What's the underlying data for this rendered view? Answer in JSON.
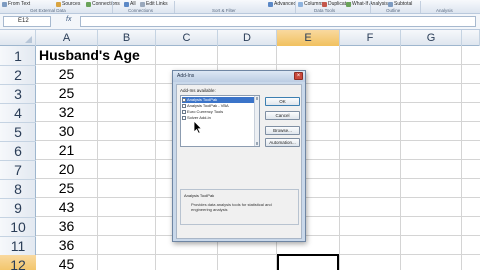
{
  "ribbon": {
    "items": [
      {
        "label": "From Text",
        "icon": "text-file-icon"
      },
      {
        "label": "Sources",
        "icon": "sources-icon"
      },
      {
        "label": "Connections",
        "icon": "connections-icon"
      },
      {
        "label": "All",
        "icon": "refresh-all-icon"
      },
      {
        "label": "Edit Links",
        "icon": "edit-links-icon"
      },
      {
        "label": "Advanced",
        "icon": "advanced-filter-icon"
      },
      {
        "label": "Columns",
        "icon": "text-to-columns-icon"
      },
      {
        "label": "Duplicates",
        "icon": "remove-duplicates-icon"
      },
      {
        "label": "What-If Analysis",
        "icon": "what-if-icon"
      },
      {
        "label": "Subtotal",
        "icon": "subtotal-icon"
      }
    ],
    "groups": [
      "Get External Data",
      "Connections",
      "Sort & Filter",
      "Data Tools",
      "Outline",
      "Analysis"
    ]
  },
  "formula_bar": {
    "name_box": "E12",
    "fx": "fx",
    "formula": ""
  },
  "grid": {
    "columns": [
      "A",
      "B",
      "C",
      "D",
      "E",
      "F",
      "G"
    ],
    "active_column": "E",
    "rows": [
      "1",
      "2",
      "3",
      "4",
      "5",
      "6",
      "7",
      "8",
      "9",
      "10",
      "11",
      "12"
    ],
    "active_row": "12",
    "header_cell": "Husband's Age",
    "ages": [
      "25",
      "25",
      "32",
      "30",
      "21",
      "20",
      "25",
      "43",
      "36",
      "36",
      "45"
    ]
  },
  "dialog": {
    "title": "Add-Ins",
    "close": "×",
    "list_label": "Add-Ins available:",
    "items": [
      {
        "label": "Analysis ToolPak",
        "checked": false,
        "selected": true
      },
      {
        "label": "Analysis ToolPak - VBA",
        "checked": false,
        "selected": false
      },
      {
        "label": "Euro Currency Tools",
        "checked": false,
        "selected": false
      },
      {
        "label": "Solver Add-in",
        "checked": false,
        "selected": false
      }
    ],
    "buttons": {
      "ok": "OK",
      "cancel": "Cancel",
      "browse": "Browse...",
      "automation": "Automation..."
    },
    "description_title": "Analysis ToolPak",
    "description": "Provides data analysis tools for statistical and engineering analysis"
  },
  "colors": {
    "active_header": "#f1c15f",
    "selected_item": "#3b74c9",
    "dialog_frame": "#c9d8ea"
  }
}
